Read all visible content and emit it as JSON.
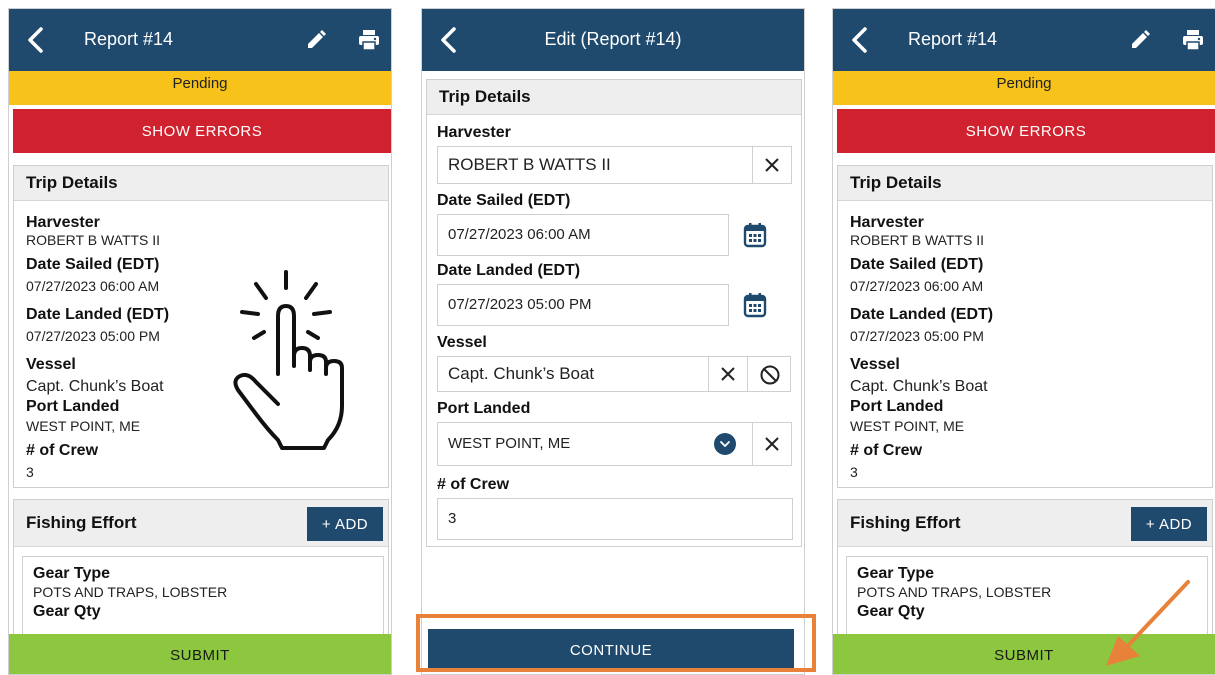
{
  "screen1": {
    "header": {
      "title": "Report #14"
    },
    "status": "Pending",
    "show_errors_label": "SHOW ERRORS",
    "trip_details": {
      "title": "Trip Details",
      "harvester_label": "Harvester",
      "harvester_value": "ROBERT B WATTS II",
      "date_sailed_label": "Date Sailed (EDT)",
      "date_sailed_value": "07/27/2023 06:00 AM",
      "date_landed_label": "Date Landed (EDT)",
      "date_landed_value": "07/27/2023 05:00 PM",
      "vessel_label": "Vessel",
      "vessel_value": "Capt. Chunk’s Boat",
      "port_label": "Port Landed",
      "port_value": "WEST POINT, ME",
      "crew_label": "# of Crew",
      "crew_value": "3"
    },
    "fishing_effort": {
      "title": "Fishing Effort",
      "add_label": "+ ADD",
      "gear_type_label": "Gear Type",
      "gear_type_value": "POTS AND TRAPS, LOBSTER",
      "gear_qty_label": "Gear Qty"
    },
    "submit_label": "SUBMIT"
  },
  "screen2": {
    "header": {
      "title": "Edit  (Report #14)"
    },
    "trip_details_title": "Trip Details",
    "harvester_label": "Harvester",
    "harvester_value": "ROBERT B WATTS II",
    "date_sailed_label": "Date Sailed (EDT)",
    "date_sailed_value": "07/27/2023 06:00 AM",
    "date_landed_label": "Date Landed (EDT)",
    "date_landed_value": "07/27/2023 05:00 PM",
    "vessel_label": "Vessel",
    "vessel_value": "Capt. Chunk’s Boat",
    "port_label": "Port Landed",
    "port_value": "WEST POINT, ME",
    "crew_label": "# of Crew",
    "crew_value": "3",
    "continue_label": "CONTINUE"
  },
  "screen3": {
    "header": {
      "title": "Report #14"
    },
    "status": "Pending",
    "show_errors_label": "SHOW ERRORS",
    "trip_details": {
      "title": "Trip Details",
      "harvester_label": "Harvester",
      "harvester_value": "ROBERT B WATTS II",
      "date_sailed_label": "Date Sailed (EDT)",
      "date_sailed_value": "07/27/2023 06:00 AM",
      "date_landed_label": "Date Landed (EDT)",
      "date_landed_value": "07/27/2023 05:00 PM",
      "vessel_label": "Vessel",
      "vessel_value": "Capt. Chunk’s Boat",
      "port_label": "Port Landed",
      "port_value": "WEST POINT, ME",
      "crew_label": "# of Crew",
      "crew_value": "3"
    },
    "fishing_effort": {
      "title": "Fishing Effort",
      "add_label": "+ ADD",
      "gear_type_label": "Gear Type",
      "gear_type_value": "POTS AND TRAPS, LOBSTER",
      "gear_qty_label": "Gear Qty"
    },
    "submit_label": "SUBMIT"
  },
  "colors": {
    "header": "#1f4a6e",
    "pending": "#f7c21a",
    "errors": "#d0222e",
    "submit": "#8dc63f",
    "highlight": "#e8823a"
  },
  "icons": [
    "back-arrow-icon",
    "pencil-icon",
    "printer-icon",
    "close-icon",
    "calendar-icon",
    "dropdown-icon",
    "block-icon",
    "tap-hand-icon",
    "pointer-arrow-icon"
  ]
}
